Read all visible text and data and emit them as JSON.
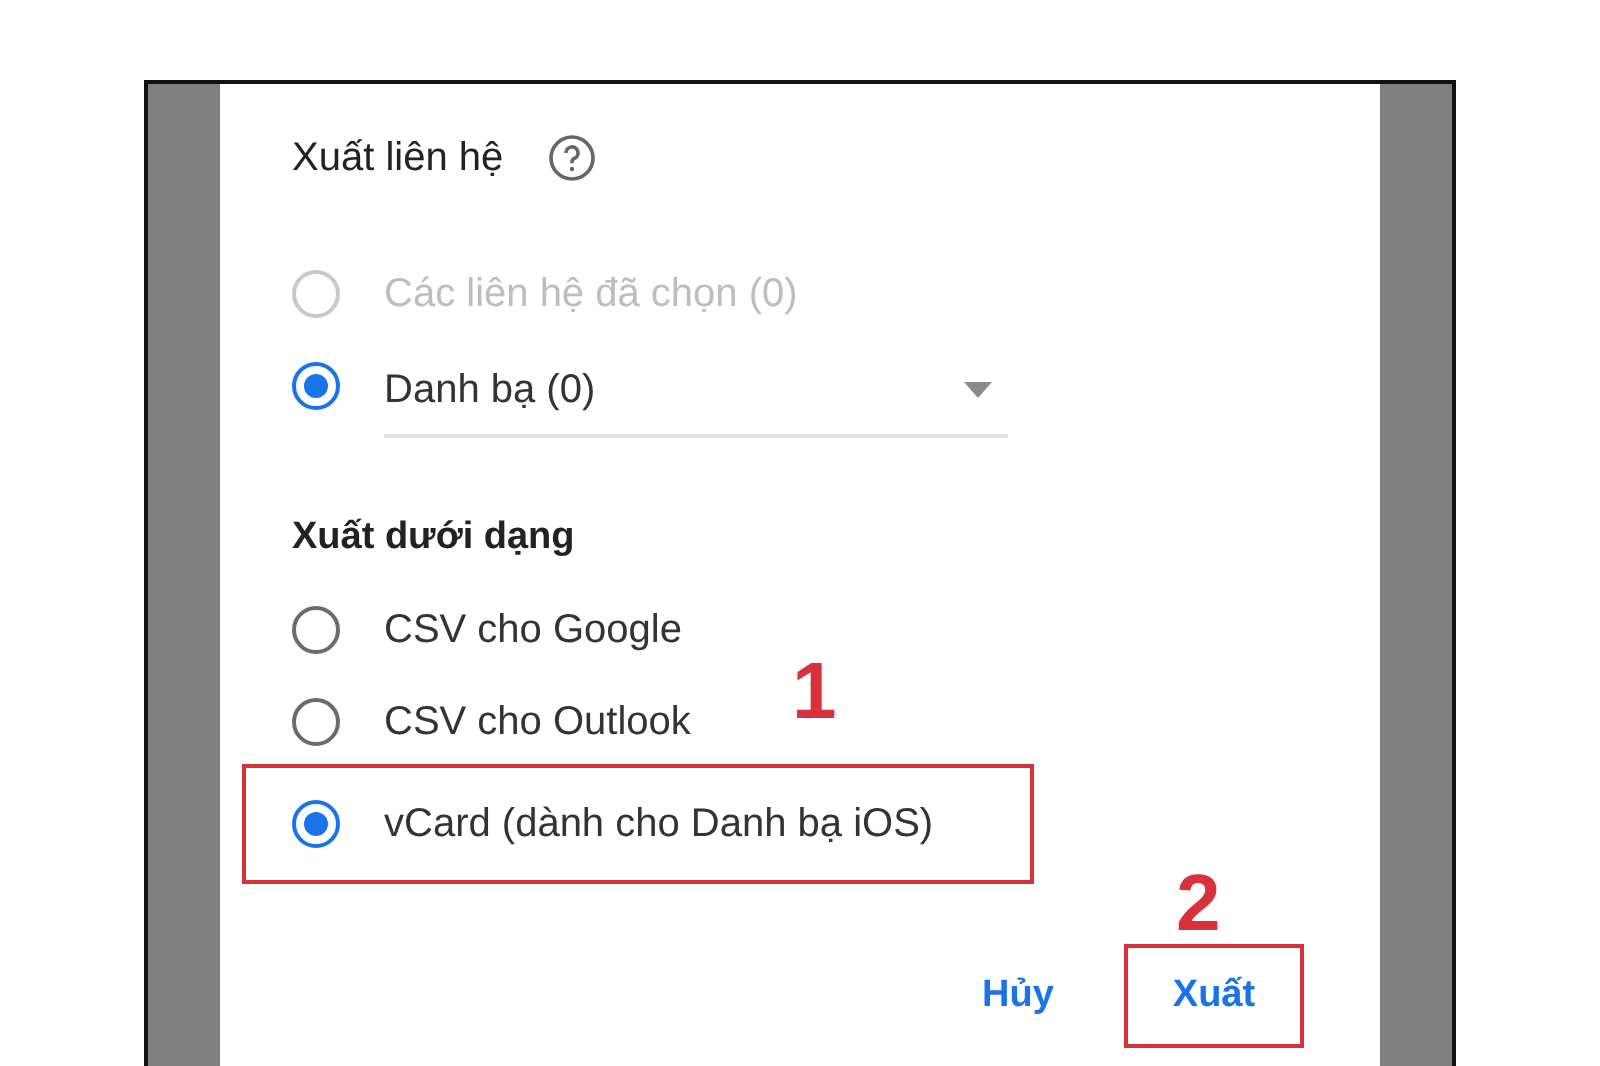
{
  "dialog": {
    "title": "Xuất liên hệ",
    "source_options": [
      {
        "label": "Các liên hệ đã chọn (0)",
        "selected": false,
        "disabled": true,
        "kind": "plain"
      },
      {
        "label": "Danh bạ (0)",
        "selected": true,
        "disabled": false,
        "kind": "dropdown"
      }
    ],
    "format_heading": "Xuất dưới dạng",
    "format_options": [
      {
        "label": "CSV cho Google",
        "selected": false,
        "highlighted": false
      },
      {
        "label": "CSV cho Outlook",
        "selected": false,
        "highlighted": false
      },
      {
        "label": "vCard (dành cho Danh bạ iOS)",
        "selected": true,
        "highlighted": true
      }
    ],
    "buttons": [
      {
        "label": "Hủy",
        "highlighted": false
      },
      {
        "label": "Xuất",
        "highlighted": true
      }
    ]
  },
  "annotations": [
    {
      "label": "1"
    },
    {
      "label": "2"
    }
  ]
}
